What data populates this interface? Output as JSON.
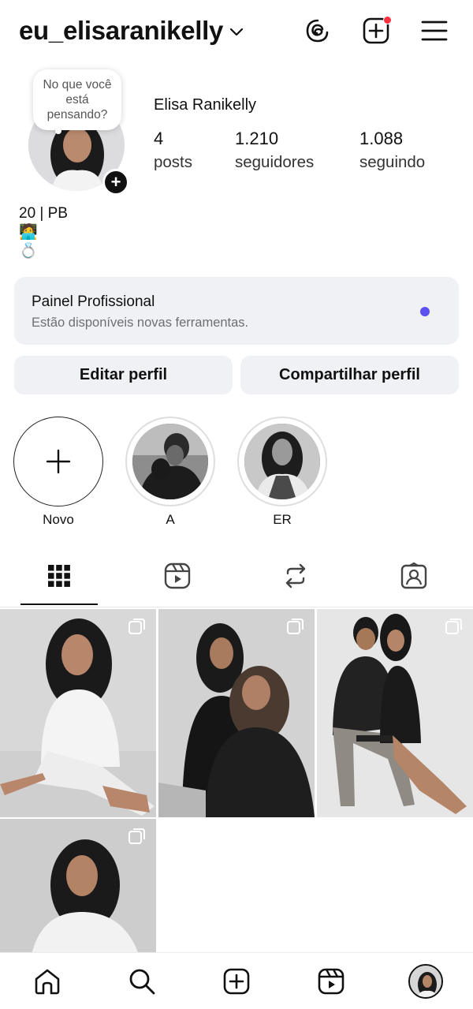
{
  "header": {
    "username": "eu_elisaranikelly",
    "icons": [
      "threads-icon",
      "create-post-icon",
      "menu-icon"
    ]
  },
  "profile": {
    "note_text": "No que você está pensando?",
    "full_name": "Elisa Ranikelly",
    "stats": [
      {
        "value": "4",
        "label": "posts"
      },
      {
        "value": "1.210",
        "label": "seguidores"
      },
      {
        "value": "1.088",
        "label": "seguindo"
      }
    ],
    "bio_line1": "20 | PB",
    "bio_line2": "🧑‍💻",
    "bio_line3": "💍"
  },
  "pro_panel": {
    "title": "Painel Profissional",
    "subtitle": "Estão disponíveis novas ferramentas.",
    "dot_color": "#5b51f0"
  },
  "buttons": {
    "edit": "Editar perfil",
    "share": "Compartilhar perfil"
  },
  "highlights": [
    {
      "label": "Novo",
      "icon": "plus-icon"
    },
    {
      "label": "A"
    },
    {
      "label": "ER"
    }
  ],
  "tabs": [
    "grid-icon",
    "reels-icon",
    "reposts-icon",
    "tagged-icon"
  ],
  "bottom_nav": [
    "home-icon",
    "search-icon",
    "create-icon",
    "reels-icon",
    "profile-avatar"
  ],
  "colors": {
    "notification": "#ff3040",
    "panel_bg": "#eff1f5"
  }
}
